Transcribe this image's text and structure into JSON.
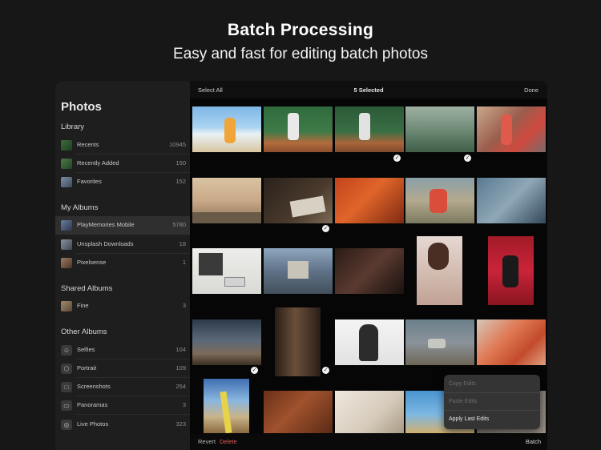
{
  "hero": {
    "title": "Batch Processing",
    "subtitle": "Easy and fast for editing batch photos"
  },
  "sidebar": {
    "title": "Photos",
    "sections": {
      "library": "Library",
      "my_albums": "My Albums",
      "shared_albums": "Shared Albums",
      "other_albums": "Other Albums"
    },
    "library_items": [
      {
        "label": "Recents",
        "count": "10945",
        "icon": "photo-thumbnail"
      },
      {
        "label": "Recently Added",
        "count": "150",
        "icon": "photo-thumbnail"
      },
      {
        "label": "Favorites",
        "count": "152",
        "icon": "photo-thumbnail"
      }
    ],
    "my_album_items": [
      {
        "label": "PlayMemories Mobile",
        "count": "5780",
        "icon": "photo-thumbnail",
        "selected": true
      },
      {
        "label": "Unsplash Downloads",
        "count": "18",
        "icon": "photo-thumbnail"
      },
      {
        "label": "Pixelsense",
        "count": "1",
        "icon": "photo-thumbnail"
      }
    ],
    "shared_album_items": [
      {
        "label": "Fine",
        "count": "3",
        "icon": "photo-thumbnail"
      }
    ],
    "other_album_items": [
      {
        "label": "Selfies",
        "count": "104",
        "icon": "selfie-icon"
      },
      {
        "label": "Portrait",
        "count": "109",
        "icon": "cube-icon"
      },
      {
        "label": "Screenshots",
        "count": "254",
        "icon": "screenshot-icon"
      },
      {
        "label": "Panoramas",
        "count": "3",
        "icon": "panorama-icon"
      },
      {
        "label": "Live Photos",
        "count": "323",
        "icon": "live-photo-icon"
      }
    ]
  },
  "topbar": {
    "select_all": "Select All",
    "selected_count": "5 Selected",
    "done": "Done"
  },
  "grid": {
    "selected_indices": [
      2,
      3,
      6,
      15,
      16
    ]
  },
  "bottombar": {
    "revert": "Revert",
    "delete": "Delete",
    "batch": "Batch"
  },
  "popover": {
    "items": [
      {
        "label": "Copy Edits",
        "enabled": false
      },
      {
        "label": "Paste Edits",
        "enabled": false
      },
      {
        "label": "Apply Last Edits",
        "enabled": true
      }
    ]
  },
  "colors": {
    "background": "#171717",
    "sidebar": "#1e1e1e",
    "selected_row": "#2f2f2f",
    "delete": "#e25b55"
  }
}
